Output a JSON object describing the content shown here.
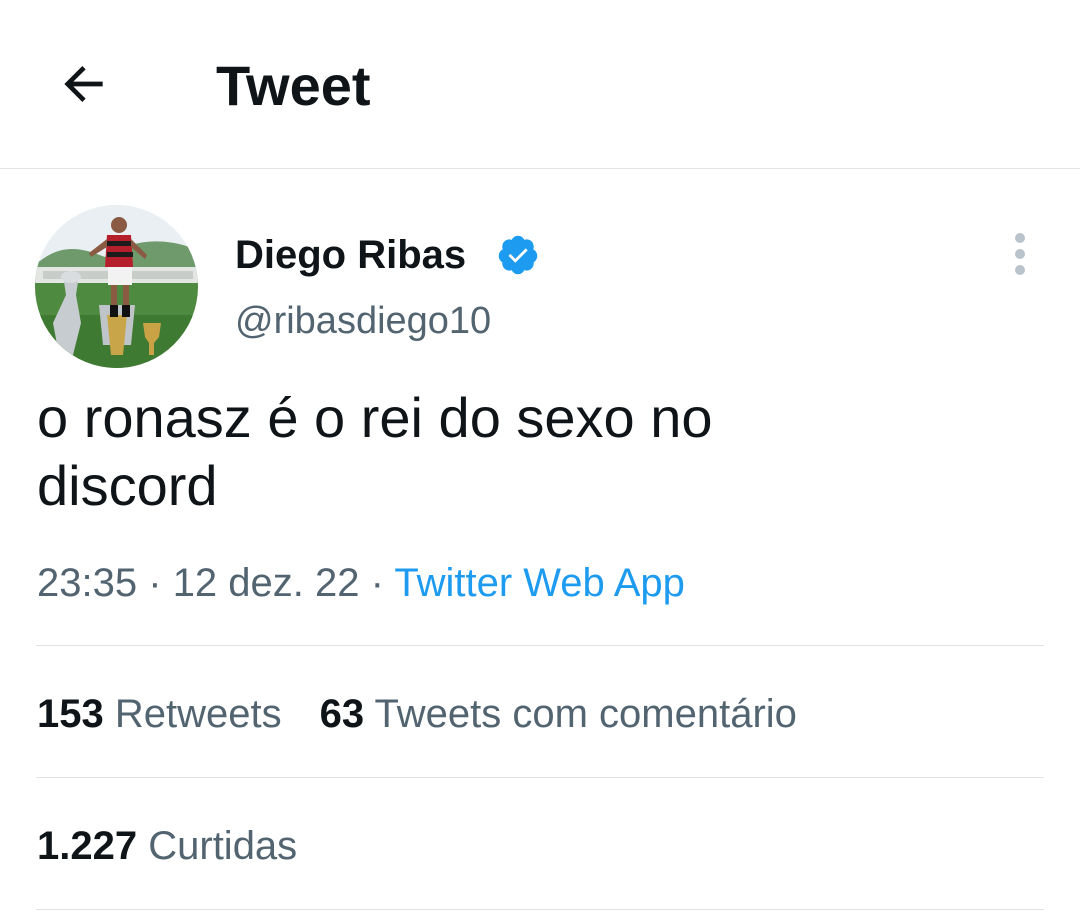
{
  "header": {
    "back_icon": "arrow-left-icon",
    "title": "Tweet"
  },
  "author": {
    "display_name": "Diego Ribas",
    "handle": "@ribasdiego10",
    "verified_icon": "verified-badge-icon",
    "avatar_icon": "avatar-photo",
    "more_icon": "more-vertical-icon"
  },
  "tweet": {
    "text": "o ronasz é o rei do sexo no\ndiscord",
    "time": "23:35",
    "date": "12 dez. 22",
    "separator": "·",
    "source": "Twitter Web App"
  },
  "stats": {
    "retweets_count": "153",
    "retweets_label": "Retweets",
    "quotes_count": "63",
    "quotes_label": "Tweets com comentário",
    "likes_count": "1.227",
    "likes_label": "Curtidas"
  },
  "colors": {
    "text_primary": "#0f1419",
    "text_secondary": "#536471",
    "accent": "#1d9bf0",
    "divider": "#dfe3e6"
  }
}
